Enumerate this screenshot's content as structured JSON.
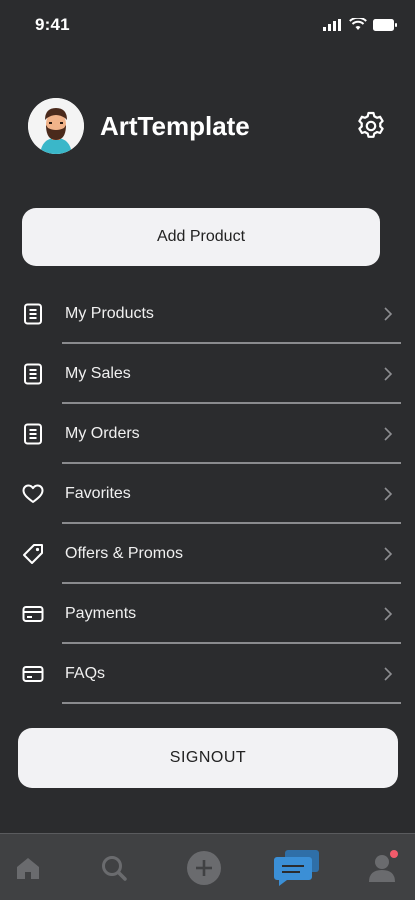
{
  "status": {
    "time": "9:41"
  },
  "profile": {
    "name": "ArtTemplate",
    "avatar_icon": "bearded-man-avatar"
  },
  "actions": {
    "add_product_label": "Add Product",
    "signout_label": "SIGNOUT"
  },
  "menu": {
    "items": [
      {
        "label": "My Products",
        "icon": "document-icon"
      },
      {
        "label": "My Sales",
        "icon": "document-icon"
      },
      {
        "label": "My Orders",
        "icon": "document-icon"
      },
      {
        "label": "Favorites",
        "icon": "heart-icon"
      },
      {
        "label": "Offers & Promos",
        "icon": "tag-icon"
      },
      {
        "label": "Payments",
        "icon": "card-icon"
      },
      {
        "label": "FAQs",
        "icon": "card-icon"
      }
    ]
  },
  "tabs": [
    {
      "name": "home",
      "icon": "home-icon"
    },
    {
      "name": "search",
      "icon": "search-icon"
    },
    {
      "name": "add",
      "icon": "plus-circle-icon"
    },
    {
      "name": "messages",
      "icon": "chat-icon",
      "active": true
    },
    {
      "name": "profile",
      "icon": "person-icon",
      "has_badge": true
    }
  ],
  "colors": {
    "background": "#2b2c2e",
    "button_bg": "#f2f2f4",
    "tab_bar": "#404143",
    "active_tab": "#3b8fd6",
    "badge": "#f25b6b"
  }
}
